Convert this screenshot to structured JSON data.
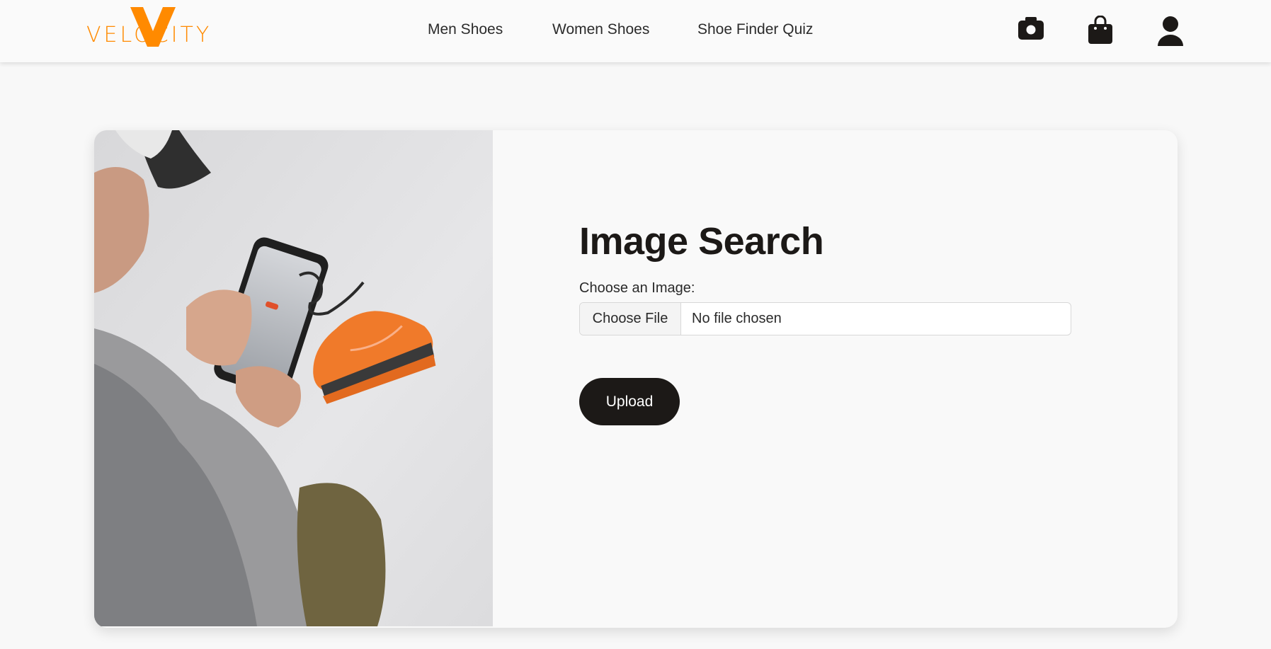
{
  "brand": {
    "name": "VELOCITY",
    "accent_color": "#ff8a00"
  },
  "nav": {
    "links": [
      {
        "label": "Men Shoes"
      },
      {
        "label": "Women Shoes"
      },
      {
        "label": "Shoe Finder Quiz"
      }
    ],
    "icons": [
      "camera-icon",
      "shopping-bag-icon",
      "user-icon"
    ]
  },
  "image_search": {
    "title": "Image Search",
    "file_label": "Choose an Image:",
    "choose_button": "Choose File",
    "file_status": "No file chosen",
    "upload_button": "Upload"
  },
  "colors": {
    "primary_dark": "#1c1917",
    "page_bg": "#f8f8f8"
  }
}
